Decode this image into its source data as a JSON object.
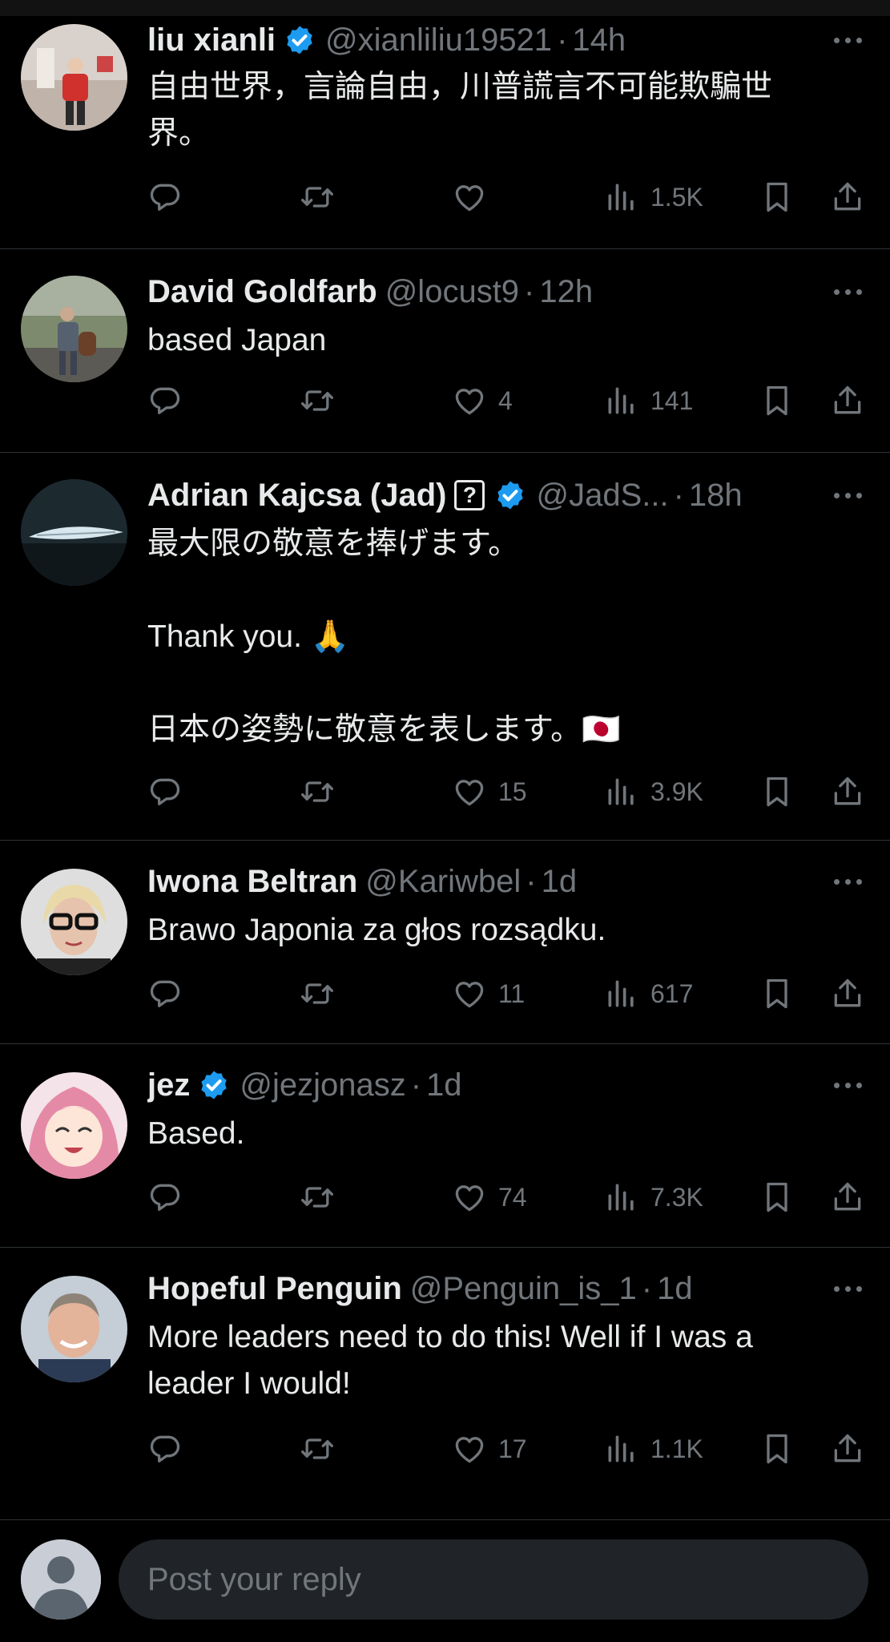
{
  "colors": {
    "background": "#000000",
    "text": "#e7e9ea",
    "muted": "#71767b",
    "verified": "#1d9bf0",
    "divider": "#2f3336"
  },
  "tweets": [
    {
      "name": "liu xianli",
      "verified": true,
      "handle": "@xianliliu19521",
      "time": "14h",
      "lines": [
        "自由世界，言論自由，川普謊言不可能欺騙世",
        "界。"
      ],
      "likes": "",
      "views": "1.5K"
    },
    {
      "name": "David Goldfarb",
      "verified": false,
      "handle": "@locust9",
      "time": "12h",
      "lines": [
        "based Japan"
      ],
      "likes": "4",
      "views": "141"
    },
    {
      "name": "Adrian Kajcsa (Jad)",
      "verified": true,
      "badge": "?",
      "handle": "@JadS...",
      "time": "18h",
      "lines": [
        "最大限の敬意を捧げます。",
        "",
        "Thank you. 🙏",
        "",
        "日本の姿勢に敬意を表します。🇯🇵"
      ],
      "likes": "15",
      "views": "3.9K"
    },
    {
      "name": "Iwona Beltran",
      "verified": false,
      "handle": "@Kariwbel",
      "time": "1d",
      "lines": [
        "Brawo Japonia za głos rozsądku."
      ],
      "likes": "11",
      "views": "617"
    },
    {
      "name": "jez",
      "verified": true,
      "handle": "@jezjonasz",
      "time": "1d",
      "lines": [
        "Based."
      ],
      "likes": "74",
      "views": "7.3K"
    },
    {
      "name": "Hopeful Penguin",
      "verified": false,
      "handle": "@Penguin_is_1",
      "time": "1d",
      "lines": [
        "More leaders need to do this! Well if I was a",
        "leader I would!"
      ],
      "likes": "17",
      "views": "1.1K"
    }
  ],
  "reply": {
    "placeholder": "Post your reply"
  }
}
